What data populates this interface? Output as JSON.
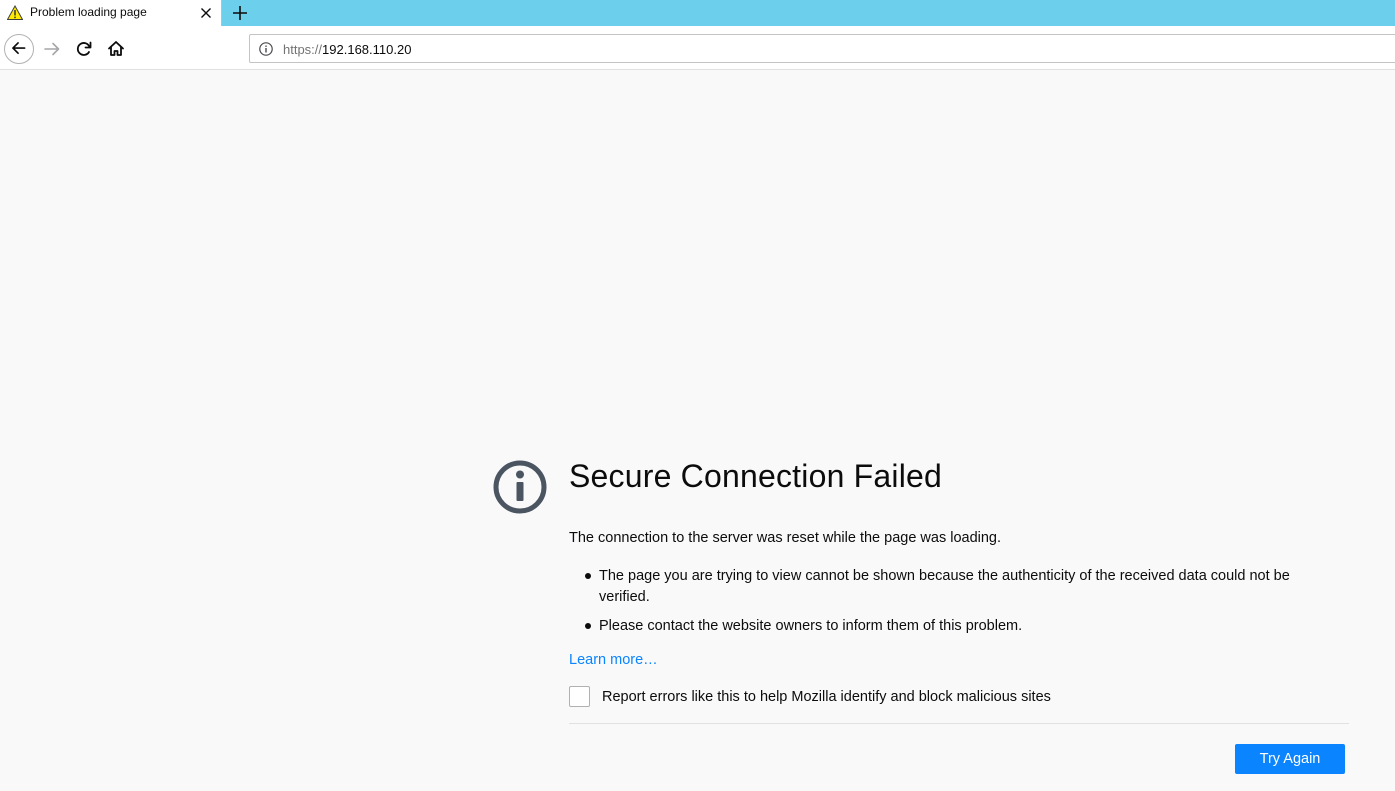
{
  "browser": {
    "tab": {
      "title": "Problem loading page",
      "icon": "warning-icon",
      "close_icon": "close-icon"
    },
    "new_tab_icon": "plus-icon",
    "nav": {
      "back_icon": "arrow-left-icon",
      "forward_icon": "arrow-right-icon",
      "reload_icon": "reload-icon",
      "home_icon": "home-icon"
    },
    "url": {
      "info_icon": "info-icon",
      "scheme": "https://",
      "host": "192.168.110.20"
    }
  },
  "error_page": {
    "icon": "info-circle-icon",
    "title": "Secure Connection Failed",
    "description": "The connection to the server was reset while the page was loading.",
    "bullets": [
      "The page you are trying to view cannot be shown because the authenticity of the received data could not be verified.",
      "Please contact the website owners to inform them of this problem."
    ],
    "learn_more": "Learn more…",
    "report_checkbox_label": "Report errors like this to help Mozilla identify and block malicious sites",
    "report_checked": false,
    "try_again_label": "Try Again"
  },
  "colors": {
    "tabstrip": "#6ccfec",
    "page_background": "#f9f9fa",
    "accent": "#0a84ff",
    "icon_dark": "#4a5561"
  }
}
